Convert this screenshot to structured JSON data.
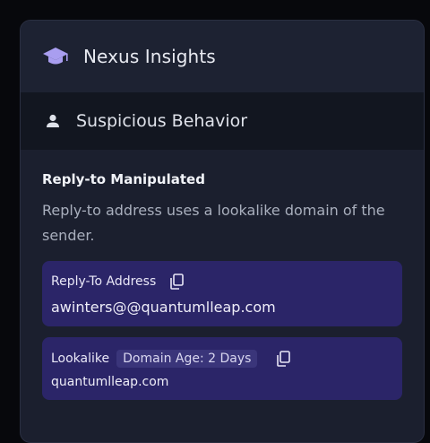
{
  "header": {
    "title": "Nexus Insights",
    "logo_icon": "graduation-cap-icon"
  },
  "section": {
    "label": "Suspicious Behavior",
    "icon": "person-icon"
  },
  "finding": {
    "title": "Reply-to Manipulated",
    "description": "Reply-to address uses a lookalike domain of the sender."
  },
  "cards": [
    {
      "label": "Reply-To Address",
      "value": "awinters@@quantumlleap.com"
    },
    {
      "label": "Lookalike",
      "badge": "Domain Age: 2 Days",
      "value": "quantumlleap.com"
    }
  ],
  "colors": {
    "panel_bg": "#1b1f2e",
    "section_bg": "#121620",
    "card_bg": "#2b2568",
    "accent": "#a99ef0"
  }
}
